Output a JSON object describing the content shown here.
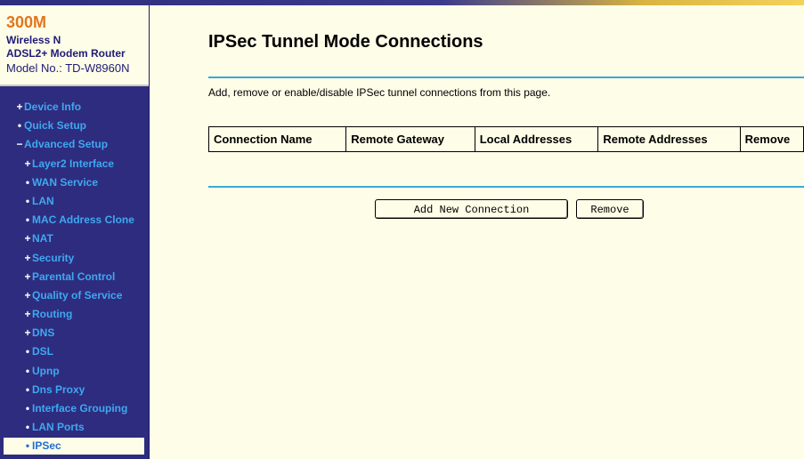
{
  "brand": {
    "title": "300M",
    "line1": "Wireless N",
    "line2": "ADSL2+ Modem Router",
    "model": "Model No.: TD-W8960N"
  },
  "menu": [
    {
      "sym": "+",
      "label": "Device Info",
      "level": "top",
      "name": "menu-item-device-info"
    },
    {
      "sym": "•",
      "label": "Quick Setup",
      "level": "top",
      "name": "menu-item-quick-setup"
    },
    {
      "sym": "−",
      "label": "Advanced Setup",
      "level": "top",
      "name": "menu-item-advanced-setup"
    },
    {
      "sym": "+",
      "label": "Layer2 Interface",
      "level": "sub",
      "name": "menu-item-layer2-interface"
    },
    {
      "sym": "•",
      "label": "WAN Service",
      "level": "sub",
      "name": "menu-item-wan-service"
    },
    {
      "sym": "•",
      "label": "LAN",
      "level": "sub",
      "name": "menu-item-lan"
    },
    {
      "sym": "•",
      "label": "MAC Address Clone",
      "level": "sub",
      "name": "menu-item-mac-address-clone"
    },
    {
      "sym": "+",
      "label": "NAT",
      "level": "sub",
      "name": "menu-item-nat"
    },
    {
      "sym": "+",
      "label": "Security",
      "level": "sub",
      "name": "menu-item-security"
    },
    {
      "sym": "+",
      "label": "Parental Control",
      "level": "sub",
      "name": "menu-item-parental-control"
    },
    {
      "sym": "+",
      "label": "Quality of Service",
      "level": "sub",
      "name": "menu-item-quality-of-service"
    },
    {
      "sym": "+",
      "label": "Routing",
      "level": "sub",
      "name": "menu-item-routing"
    },
    {
      "sym": "+",
      "label": "DNS",
      "level": "sub",
      "name": "menu-item-dns"
    },
    {
      "sym": "•",
      "label": "DSL",
      "level": "sub",
      "name": "menu-item-dsl"
    },
    {
      "sym": "•",
      "label": "Upnp",
      "level": "sub",
      "name": "menu-item-upnp"
    },
    {
      "sym": "•",
      "label": "Dns Proxy",
      "level": "sub",
      "name": "menu-item-dns-proxy"
    },
    {
      "sym": "•",
      "label": "Interface Grouping",
      "level": "sub",
      "name": "menu-item-interface-grouping"
    },
    {
      "sym": "•",
      "label": "LAN Ports",
      "level": "sub",
      "name": "menu-item-lan-ports"
    },
    {
      "sym": "•",
      "label": "IPSec",
      "level": "sub",
      "name": "menu-item-ipsec",
      "active": true
    }
  ],
  "page": {
    "title": "IPSec Tunnel Mode Connections",
    "description": "Add, remove or enable/disable IPSec tunnel connections from this page."
  },
  "table": {
    "headers": [
      "Connection Name",
      "Remote Gateway",
      "Local Addresses",
      "Remote Addresses",
      "Remove"
    ]
  },
  "buttons": {
    "add": "Add New Connection",
    "remove": "Remove"
  },
  "colors": {
    "sidebar_bg": "#2e2c7e",
    "menu_text": "#3fa8f0",
    "accent_line": "#3aa8dc",
    "page_bg": "#fefde7",
    "brand_orange": "#e2761d"
  }
}
